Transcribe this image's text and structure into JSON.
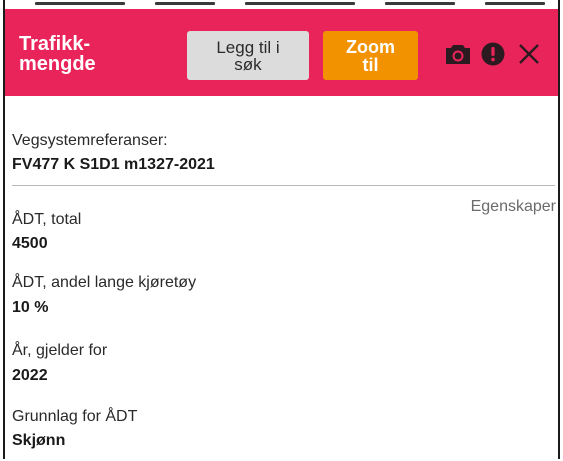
{
  "header": {
    "title": "Trafikk-\nmengde",
    "add_to_search_label": "Legg til i\nsøk",
    "zoom_label": "Zoom\ntil",
    "background_color": "#e9245a",
    "zoom_color": "#f39200",
    "icons": [
      "camera-icon",
      "alert-icon",
      "close-icon"
    ]
  },
  "reference": {
    "label": "Vegsystemreferanser:",
    "value": "FV477 K S1D1 m1327-2021"
  },
  "properties_link": "Egenskaper",
  "properties": [
    {
      "label": "ÅDT, total",
      "value": "4500"
    },
    {
      "label": "ÅDT, andel lange kjøretøy",
      "value": "10 %"
    },
    {
      "label": "År, gjelder for",
      "value": "2022"
    },
    {
      "label": "Grunnlag for ÅDT",
      "value": "Skjønn"
    }
  ]
}
